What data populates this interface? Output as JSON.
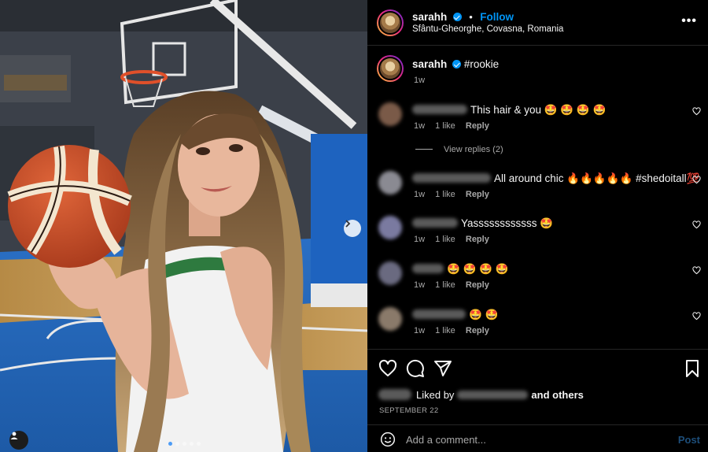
{
  "post": {
    "username": "sarahh",
    "follow_label": "Follow",
    "separator": "•",
    "location": "Sfântu-Gheorghe, Covasna, Romania",
    "more_label": "•••"
  },
  "caption": {
    "username": "sarahh",
    "text": "#rookie",
    "time": "1w"
  },
  "comments": [
    {
      "text": "This hair & you 🤩 🤩 🤩 🤩",
      "time": "1w",
      "likes": "1 like",
      "reply": "Reply"
    },
    {
      "text": "All around chic 🔥🔥🔥🔥🔥 #shedoitall💯",
      "time": "1w",
      "likes": "1 like",
      "reply": "Reply"
    },
    {
      "text": "Yassssssssssss 🤩",
      "time": "1w",
      "likes": "1 like",
      "reply": "Reply"
    },
    {
      "text": "🤩 🤩 🤩 🤩",
      "time": "1w",
      "likes": "1 like",
      "reply": "Reply"
    },
    {
      "text": "🤩 🤩",
      "time": "1w",
      "likes": "1 like",
      "reply": "Reply"
    }
  ],
  "view_replies": "View replies (2)",
  "likes": {
    "liked_by": "Liked by",
    "and_others": "and others",
    "date": "SEPTEMBER 22"
  },
  "add_comment": {
    "placeholder": "Add a comment...",
    "post_label": "Post"
  },
  "carousel": {
    "count": 5,
    "active": 1
  },
  "colors": {
    "accent": "#0095f6",
    "muted": "#a8a8a8",
    "background": "#000000"
  },
  "icons": [
    "heart-icon",
    "comment-icon",
    "share-icon",
    "bookmark-icon",
    "emoji-icon",
    "chevron-right-icon",
    "user-tag-icon",
    "more-icon",
    "verified-icon"
  ]
}
